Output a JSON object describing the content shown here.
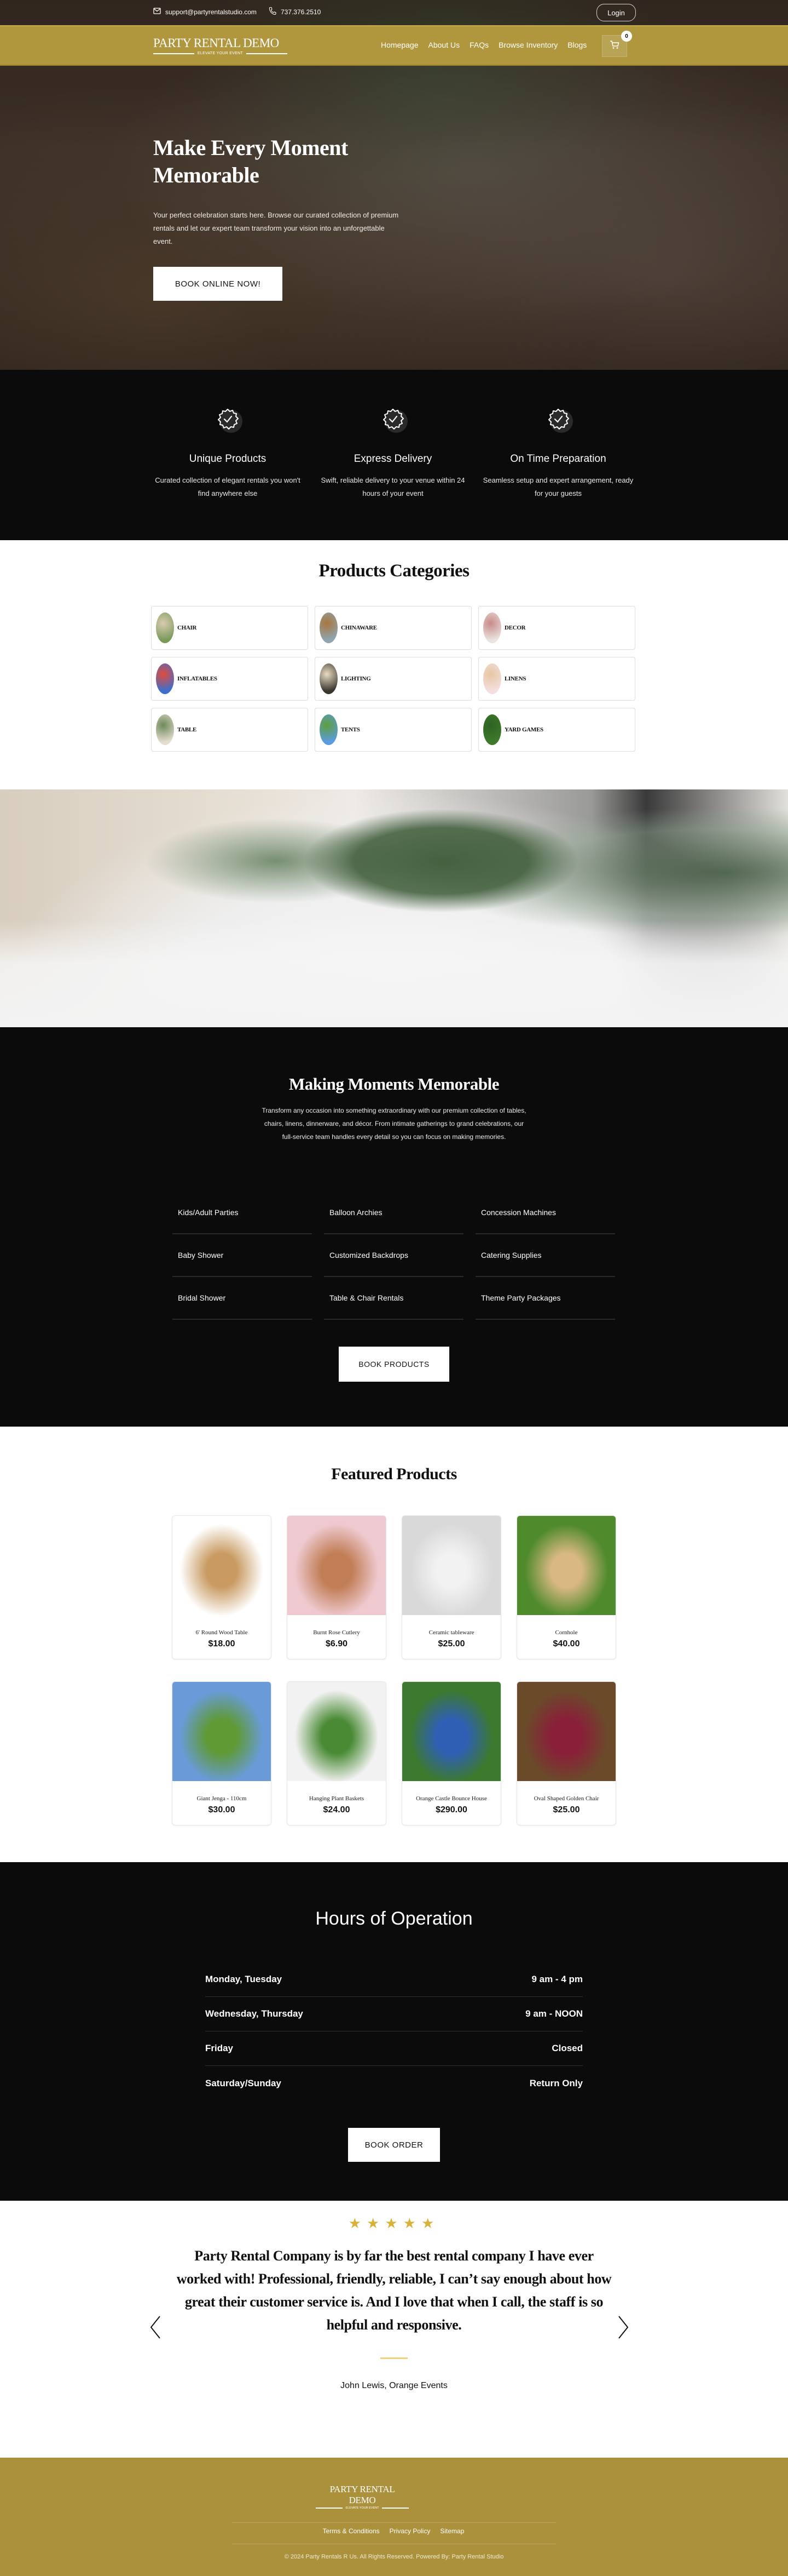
{
  "topbar": {
    "email": "support@partyrentalstudio.com",
    "phone": "737.376.2510",
    "login_label": "Login"
  },
  "brand": {
    "name": "PARTY RENTAL DEMO",
    "tagline": "ELEVATE YOUR EVENT",
    "accent_color": "#b0973e",
    "footer_color": "#ab913c",
    "dark_color": "#0b0b0b"
  },
  "nav": {
    "links": [
      "Homepage",
      "About Us",
      "FAQs",
      "Browse Inventory",
      "Blogs"
    ],
    "cart_count": "0"
  },
  "hero": {
    "title": "Make Every Moment Memorable",
    "subtitle": "Your perfect celebration starts here. Browse our curated collection of premium rentals and let our expert team transform your vision into an unforgettable event.",
    "cta_label": "BOOK ONLINE NOW!"
  },
  "features": [
    {
      "icon": "verified-badge-icon",
      "title": "Unique Products",
      "text": "Curated collection of elegant rentals you won't find anywhere else"
    },
    {
      "icon": "verified-badge-icon",
      "title": "Express Delivery",
      "text": "Swift, reliable delivery to your venue within 24 hours of your event"
    },
    {
      "icon": "verified-badge-icon",
      "title": "On Time Preparation",
      "text": "Seamless setup and expert arrangement, ready for your guests"
    }
  ],
  "categories": {
    "title": "Products Categories",
    "items": [
      {
        "label": "CHAIR",
        "thumb": [
          "#7a9a5a",
          "#d9cbb0"
        ]
      },
      {
        "label": "CHINAWARE",
        "thumb": [
          "#8fa6b2",
          "#a7773d"
        ]
      },
      {
        "label": "DECOR",
        "thumb": [
          "#e9e4df",
          "#c98a8a"
        ]
      },
      {
        "label": "INFLATABLES",
        "thumb": [
          "#3b6fcf",
          "#e14b3c"
        ]
      },
      {
        "label": "LIGHTING",
        "thumb": [
          "#3a342e",
          "#e9dcc2"
        ]
      },
      {
        "label": "LINENS",
        "thumb": [
          "#f4dfe0",
          "#e6c7a4"
        ]
      },
      {
        "label": "TABLE",
        "thumb": [
          "#e5ddd0",
          "#6e8a5a"
        ]
      },
      {
        "label": "TENTS",
        "thumb": [
          "#5c9be0",
          "#5e9e3c"
        ]
      },
      {
        "label": "YARD GAMES",
        "thumb": [
          "#3f7a2a",
          "#2d6324"
        ]
      }
    ]
  },
  "moments": {
    "title": "Making Moments Memorable",
    "intro": "Transform any occasion into something extraordinary with our premium collection of tables, chairs, linens, dinnerware, and décor. From intimate gatherings to grand celebrations, our full-service team handles every detail so you can focus on making memories.",
    "services": [
      "Kids/Adult Parties",
      "Balloon Archies",
      "Concession Machines",
      "Baby Shower",
      "Customized Backdrops",
      "Catering Supplies",
      "Bridal Shower",
      "Table & Chair Rentals",
      "Theme Party Packages"
    ],
    "cta_label": "BOOK PRODUCTS"
  },
  "featured": {
    "title": "Featured Products",
    "products": [
      {
        "name": "6' Round Wood Table",
        "price": "$18.00",
        "img": [
          "#ffffff",
          "#c99b63"
        ]
      },
      {
        "name": "Burnt Rose Cutlery",
        "price": "$6.90",
        "img": [
          "#eec9cf",
          "#c17d55"
        ]
      },
      {
        "name": "Ceramic tableware",
        "price": "$25.00",
        "img": [
          "#d9d9d9",
          "#f2f2f2"
        ]
      },
      {
        "name": "Cornhole",
        "price": "$40.00",
        "img": [
          "#4f8a2c",
          "#d9b883"
        ]
      },
      {
        "name": "Giant Jenga - 110cm",
        "price": "$30.00",
        "img": [
          "#6a9bd8",
          "#5f9a35"
        ]
      },
      {
        "name": "Hanging Plant Baskets",
        "price": "$24.00",
        "img": [
          "#f2f2f2",
          "#4a8a35"
        ]
      },
      {
        "name": "Orange Castle Bounce House",
        "price": "$290.00",
        "img": [
          "#3d7a2d",
          "#2f5fb5"
        ]
      },
      {
        "name": "Oval Shaped Golden Chair",
        "price": "$25.00",
        "img": [
          "#6b4a2a",
          "#8a1f3a"
        ]
      }
    ]
  },
  "hours": {
    "title": "Hours of Operation",
    "rows": [
      {
        "day": "Monday, Tuesday",
        "time": "9 am - 4 pm"
      },
      {
        "day": "Wednesday, Thursday",
        "time": "9 am - NOON"
      },
      {
        "day": "Friday",
        "time": "Closed"
      },
      {
        "day": "Saturday/Sunday",
        "time": "Return Only"
      }
    ],
    "cta_label": "BOOK ORDER"
  },
  "testimonial": {
    "rating": 5,
    "stars": "★★★★★",
    "quote": "Party Rental Company is by far the best rental company I have ever worked with! Professional, friendly, reliable, I can’t say enough about how great their customer service is. And I love that when I call, the staff is so helpful and responsive.",
    "author": "John Lewis, Orange Events",
    "star_color": "#d9b23a"
  },
  "footer": {
    "links": [
      "Terms & Conditions",
      "Privacy Policy",
      "Sitemap"
    ],
    "copyright": "© 2024 Party Rentals R Us. All Rights Reserved. Powered By: Party Rental Studio"
  }
}
